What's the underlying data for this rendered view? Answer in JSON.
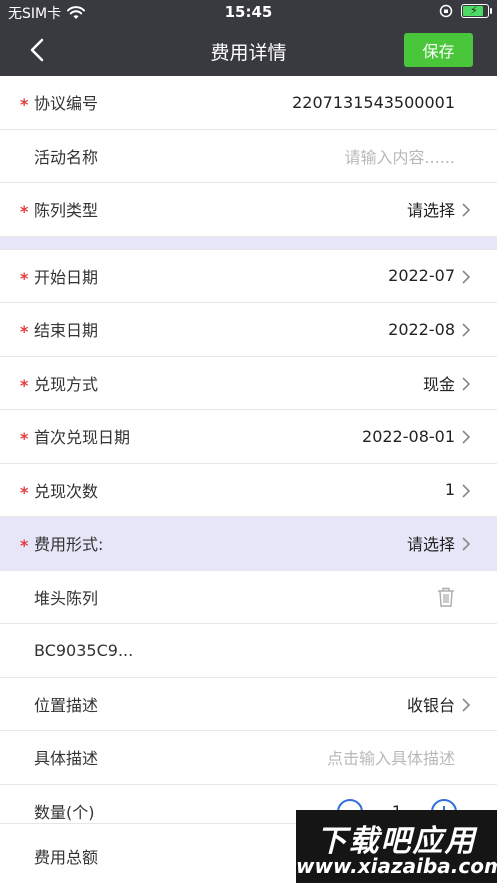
{
  "status_bar": {
    "carrier": "无SIM卡",
    "time": "15:45"
  },
  "nav": {
    "title": "费用详情",
    "save_label": "保存"
  },
  "rows_top": [
    {
      "label": "协议编号",
      "value": "2207131543500001",
      "required": true,
      "placeholder": false,
      "arrow": false
    },
    {
      "label": "活动名称",
      "value": "请输入内容......",
      "required": false,
      "placeholder": true,
      "arrow": false
    },
    {
      "label": "陈列类型",
      "value": "请选择",
      "required": true,
      "placeholder": false,
      "arrow": true
    }
  ],
  "rows_mid": [
    {
      "label": "开始日期",
      "value": "2022-07",
      "required": true
    },
    {
      "label": "结束日期",
      "value": "2022-08",
      "required": true
    },
    {
      "label": "兑现方式",
      "value": "现金",
      "required": true
    },
    {
      "label": "首次兑现日期",
      "value": "2022-08-01",
      "required": true
    },
    {
      "label": "兑现次数",
      "value": "1",
      "required": true
    }
  ],
  "fee_form": {
    "label": "费用形式:",
    "value": "请选择",
    "required": true
  },
  "display_item": {
    "label": "堆头陈列",
    "code": "BC9035C9..."
  },
  "location": {
    "label": "位置描述",
    "value": "收银台"
  },
  "detail": {
    "label": "具体描述",
    "placeholder": "点击输入具体描述"
  },
  "quantity": {
    "label": "数量(个)",
    "value": "1"
  },
  "total": {
    "label": "费用总额"
  },
  "watermark": {
    "title": "下载吧应用",
    "url": "www.xiazaiba.com"
  },
  "colors": {
    "header": "#383a40",
    "save": "#4ac63a",
    "required": "#e23c3c",
    "highlight": "#e6e6f8",
    "stepper": "#2f6fdf"
  }
}
